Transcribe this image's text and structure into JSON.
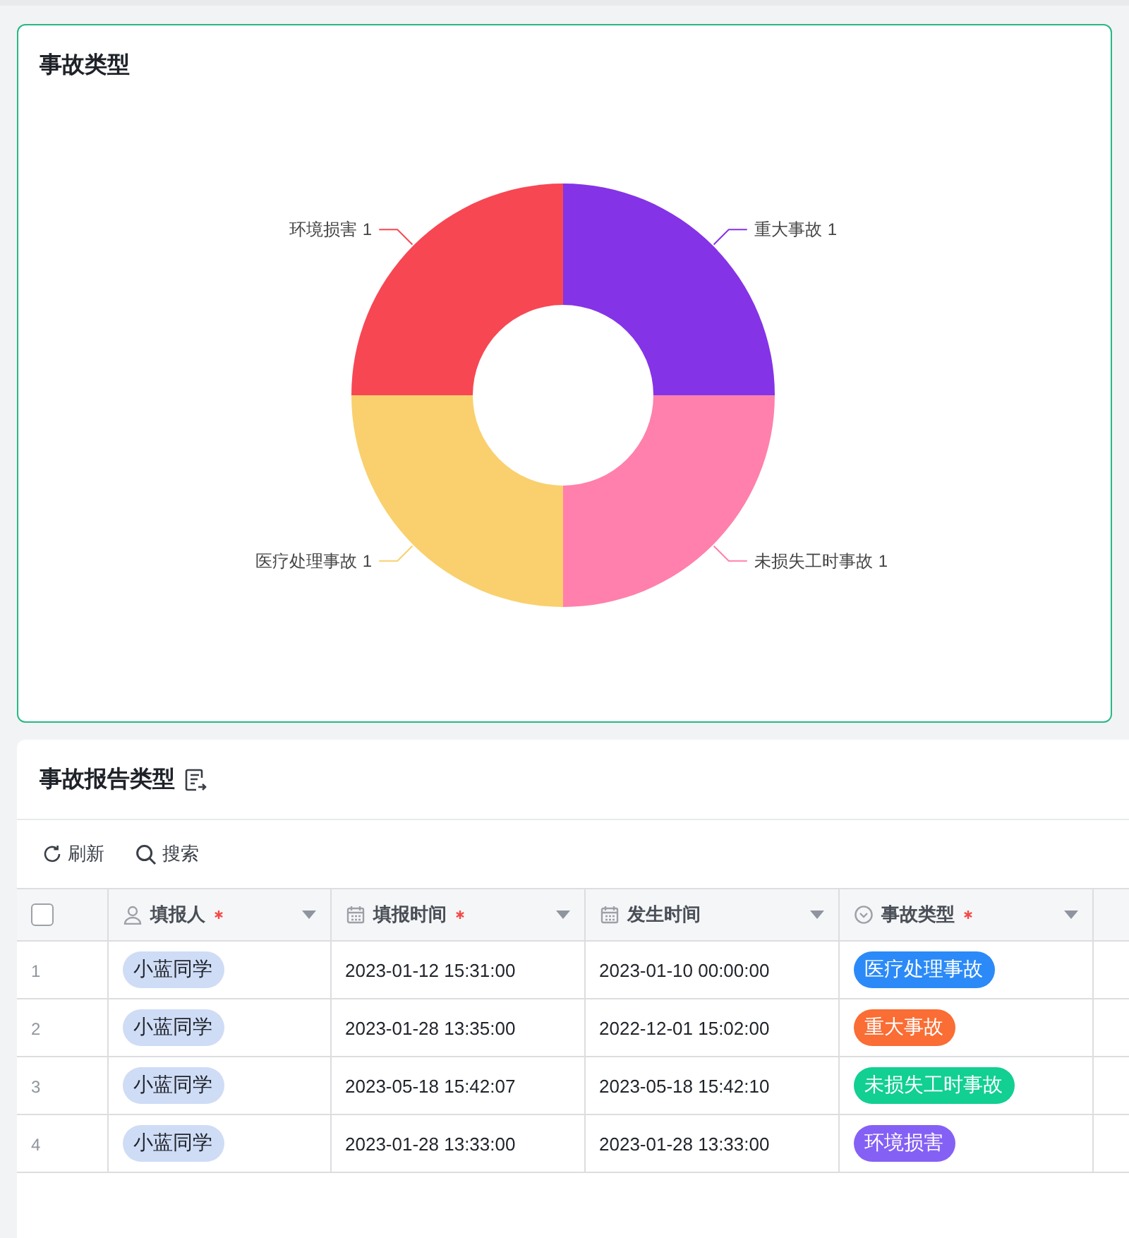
{
  "chart_card": {
    "title": "事故类型",
    "chart_data": {
      "type": "donut",
      "categories": [
        "重大事故",
        "未损失工时事故",
        "医疗处理事故",
        "环境损害"
      ],
      "values": [
        1,
        1,
        1,
        1
      ],
      "data_labels": true
    }
  },
  "report_panel": {
    "title": "事故报告类型",
    "toolbar": [
      {
        "kind": "refresh",
        "label": "刷新"
      },
      {
        "kind": "search",
        "label": "搜索"
      }
    ],
    "table": {
      "select_all": {
        "checked": false
      },
      "columns": [
        {
          "kind": "person",
          "label": "填报人",
          "required": true
        },
        {
          "kind": "date",
          "label": "填报时间",
          "required": true
        },
        {
          "kind": "date",
          "label": "发生时间",
          "required": false
        },
        {
          "kind": "select",
          "label": "事故类型",
          "required": true
        }
      ],
      "rows": [
        {
          "index": "1",
          "reporter": "小蓝同学",
          "reported_at": "2023-01-12 15:31:00",
          "occurred_at": "2023-01-10 00:00:00",
          "type": {
            "label": "医疗处理事故",
            "color": "#2b8af7"
          }
        },
        {
          "index": "2",
          "reporter": "小蓝同学",
          "reported_at": "2023-01-28 13:35:00",
          "occurred_at": "2022-12-01 15:02:00",
          "type": {
            "label": "重大事故",
            "color": "#fa6d34"
          }
        },
        {
          "index": "3",
          "reporter": "小蓝同学",
          "reported_at": "2023-05-18 15:42:07",
          "occurred_at": "2023-05-18 15:42:10",
          "type": {
            "label": "未损失工时事故",
            "color": "#12cf92"
          }
        },
        {
          "index": "4",
          "reporter": "小蓝同学",
          "reported_at": "2023-01-28 13:33:00",
          "occurred_at": "2023-01-28 13:33:00",
          "type": {
            "label": "环境损害",
            "color": "#8560f5"
          }
        }
      ]
    }
  }
}
